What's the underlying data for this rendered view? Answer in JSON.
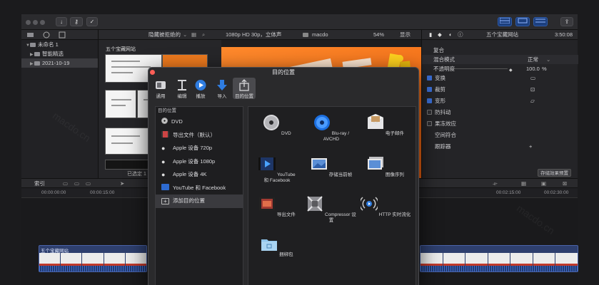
{
  "toolbar": {
    "import_label": "↓",
    "key_label": "⚷",
    "check_label": "✓",
    "share_label": "⇪"
  },
  "library": {
    "items": [
      {
        "label": "未命名 1"
      },
      {
        "label": "智能精选"
      },
      {
        "label": "2021-10-19"
      }
    ]
  },
  "browser": {
    "filter_label": "隐藏被拒绝的",
    "event_title": "五个宝藏网站",
    "status": "已选定 1"
  },
  "viewer": {
    "format": "1080p HD 30p，立体声",
    "project": "macdo",
    "zoom": "54%",
    "display_label": "显示"
  },
  "inspector": {
    "clip_title": "五个宝藏网站",
    "timecode": "3:50:08",
    "section_composite": "复合",
    "blend_label": "混合模式",
    "blend_value": "正常",
    "opacity_label": "不透明度",
    "opacity_value": "100.0",
    "opacity_unit": "%",
    "transform": "变换",
    "crop": "裁剪",
    "distort": "变形",
    "stabilize": "防抖动",
    "rolling_shutter": "果冻效应",
    "spatial": "空间符合",
    "tracker": "跟踪器",
    "save_preset": "存储效果预置"
  },
  "timeline": {
    "index_label": "索引",
    "ruler": [
      "00:00:00:00",
      "00:00:15:00",
      "00:02:15:00",
      "00:02:30:00"
    ],
    "clip_title": "五个宝藏网站"
  },
  "dialog": {
    "title": "目的位置",
    "tools": [
      {
        "label": "通用"
      },
      {
        "label": "编辑"
      },
      {
        "label": "播放"
      },
      {
        "label": "导入"
      },
      {
        "label": "目的位置"
      }
    ],
    "side_header": "目的位置",
    "side_items": [
      {
        "label": "DVD"
      },
      {
        "label": "导出文件（默认）"
      },
      {
        "label": "Apple 设备 720p"
      },
      {
        "label": "Apple 设备 1080p"
      },
      {
        "label": "Apple 设备 4K"
      },
      {
        "label": "YouTube 和 Facebook"
      },
      {
        "label": "添加目的位置"
      }
    ],
    "grid": [
      {
        "label": "DVD"
      },
      {
        "label": "Blu-ray / AVCHD"
      },
      {
        "label": "电子邮件"
      },
      {
        "label": "YouTube\n和 Facebook"
      },
      {
        "label": "存储当前帧"
      },
      {
        "label": "图像序列"
      },
      {
        "label": "导出文件"
      },
      {
        "label": "Compressor 设置"
      },
      {
        "label": "HTTP 实时流化"
      },
      {
        "label": "捆绑包"
      }
    ]
  }
}
